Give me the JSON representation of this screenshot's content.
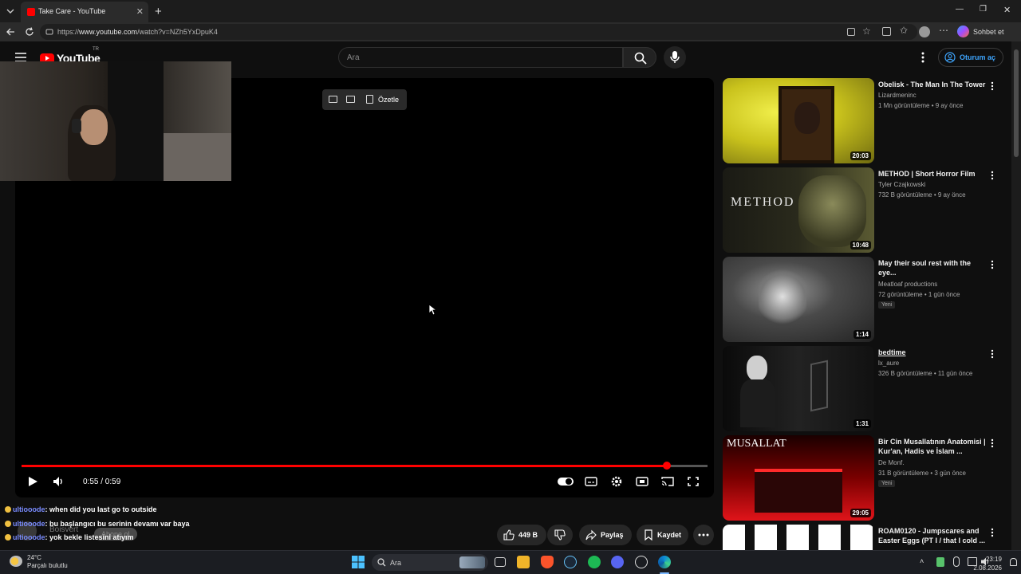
{
  "browser": {
    "tab_title": "Take Care - YouTube",
    "url_prefix": "https://",
    "url_host": "www.youtube.com",
    "url_path": "/watch?v=NZh5YxDpuK4",
    "copilot_label": "Sohbet et"
  },
  "masthead": {
    "logo_text": "YouTube",
    "region": "TR",
    "search_placeholder": "Ara",
    "signin_label": "Oturum aç"
  },
  "player": {
    "summarize_label": "Özetle",
    "time": "0:55 / 0:59",
    "progress": 0.941
  },
  "actions": {
    "likes": "449 B",
    "share": "Paylaş",
    "save": "Kaydet"
  },
  "chat": {
    "overlay_text": "Boisvert",
    "overlay_button": "Abone ol",
    "lines": [
      {
        "user": "ultiooode",
        "text": ": when did you last go to outside"
      },
      {
        "user": "ultiooode",
        "text": ": bu başlangıcı bu serinin devamı var baya"
      },
      {
        "user": "ultiooode",
        "text": ": yok bekle listesini atıyım"
      }
    ]
  },
  "recommendations": [
    {
      "title": "Obelisk - The Man In The Tower",
      "channel": "Lizardmeninc",
      "meta": "1 Mn görüntüleme • 9 ay önce",
      "duration": "20:03",
      "badge": ""
    },
    {
      "title": "METHOD | Short Horror Film",
      "channel": "Tyler Czajkowski",
      "meta": "732 B görüntüleme • 9 ay önce",
      "duration": "10:48",
      "badge": "",
      "thumb_text": "METHOD"
    },
    {
      "title": "May their soul rest with the eye...",
      "channel": "Meatloaf productions",
      "meta": "72 görüntüleme • 1 gün önce",
      "duration": "1:14",
      "badge": "Yeni"
    },
    {
      "title": "bedtime",
      "channel": "lx_aure",
      "meta": "326 B görüntüleme • 11 gün önce",
      "duration": "1:31",
      "badge": ""
    },
    {
      "title": "Bir Cin Musallatının Anatomisi | Kur'an, Hadis ve İslam ...",
      "channel": "De Monf.",
      "meta": "31 B görüntüleme • 3 gün önce",
      "duration": "29:05",
      "badge": "Yeni",
      "thumb_text": "MUSALLAT"
    },
    {
      "title": "ROAM0120 - Jumpscares and Easter Eggs (PT I / that I cold ...",
      "channel": "",
      "meta": "",
      "duration": "",
      "badge": ""
    }
  ],
  "taskbar": {
    "temperature": "24°C",
    "weather": "Parçalı bulutlu",
    "search_label": "Ara",
    "time": "23:19",
    "date": "2.08.2026"
  },
  "colors": {
    "accent_red": "#ff0000",
    "link_blue": "#3ea6ff",
    "background": "#0f0f0f"
  }
}
